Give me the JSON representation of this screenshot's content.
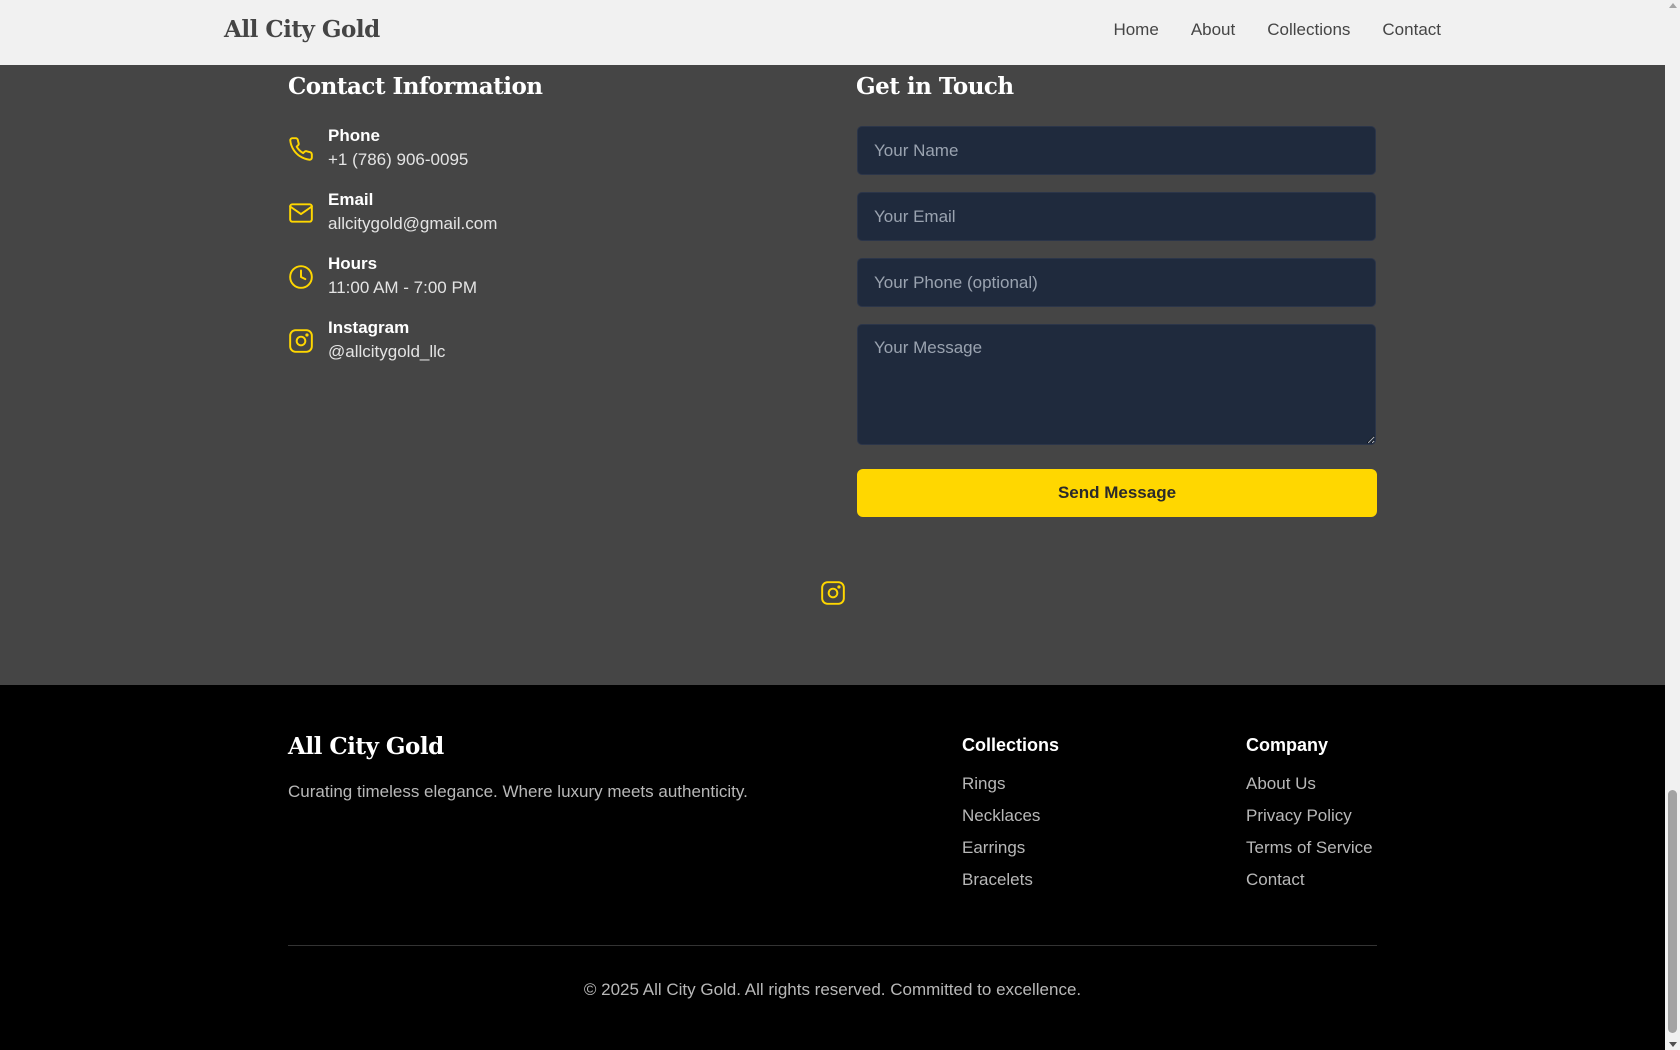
{
  "header": {
    "brand": "All City Gold",
    "nav": [
      "Home",
      "About",
      "Collections",
      "Contact"
    ]
  },
  "contact_info": {
    "title": "Contact Information",
    "items": [
      {
        "icon": "phone-icon",
        "label": "Phone",
        "value": "+1 (786) 906-0095"
      },
      {
        "icon": "mail-icon",
        "label": "Email",
        "value": "allcitygold@gmail.com"
      },
      {
        "icon": "clock-icon",
        "label": "Hours",
        "value": "11:00 AM - 7:00 PM"
      },
      {
        "icon": "instagram-icon",
        "label": "Instagram",
        "value": "@allcitygold_llc"
      }
    ]
  },
  "form": {
    "title": "Get in Touch",
    "name_placeholder": "Your Name",
    "email_placeholder": "Your Email",
    "phone_placeholder": "Your Phone (optional)",
    "message_placeholder": "Your Message",
    "submit_label": "Send Message"
  },
  "footer": {
    "brand": "All City Gold",
    "tagline": "Curating timeless elegance. Where luxury meets authenticity.",
    "collections_title": "Collections",
    "collections": [
      "Rings",
      "Necklaces",
      "Earrings",
      "Bracelets"
    ],
    "company_title": "Company",
    "company": [
      "About Us",
      "Privacy Policy",
      "Terms of Service",
      "Contact"
    ],
    "copyright": "© 2025 All City Gold. All rights reserved. Committed to excellence."
  },
  "colors": {
    "accent": "#ffd700",
    "section_bg": "#454545",
    "header_bg": "#f1f1f1",
    "input_bg": "#1f2a3d",
    "footer_bg": "#000000"
  }
}
